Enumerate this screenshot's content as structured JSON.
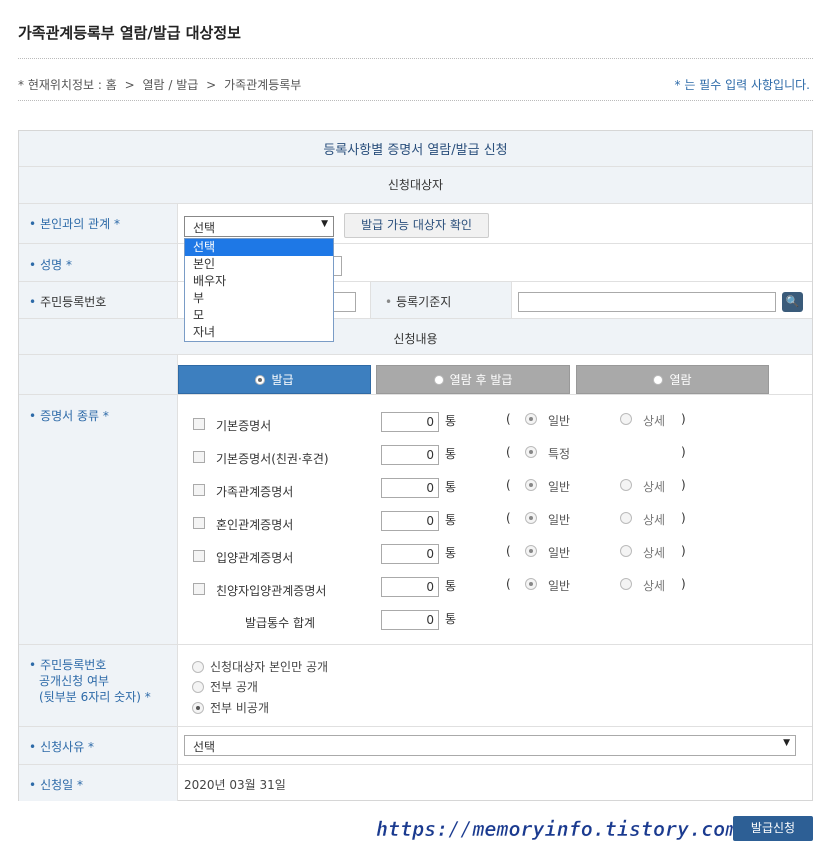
{
  "page": {
    "title": "가족관계등록부 열람/발급 대상정보",
    "location": [
      "* 현재위치정보 : 홈",
      ">",
      "열람 / 발급",
      ">",
      "가족관계등록부"
    ],
    "required_note": "* 는 필수 입력 사항입니다."
  },
  "form": {
    "caption": "등록사항별 증명서 열람/발급 신청",
    "section_applicant": "신청대상자",
    "relation_label": "본인과의 관계 *",
    "relation_value": "선택",
    "relation_options": [
      "선택",
      "본인",
      "배우자",
      "부",
      "모",
      "자녀"
    ],
    "check_button": "발급 가능 대상자 확인",
    "name_label": "성명 *",
    "rrn_label": "주민등록번호",
    "base_label": "등록기준지",
    "section_content": "신청내용",
    "tabs": [
      "발급",
      "열람 후 발급",
      "열람"
    ],
    "cert_type_label": "증명서 종류 *",
    "certificates": [
      {
        "label": "기본증명서",
        "count": "0",
        "unit": "통",
        "opt1": "일반",
        "opt2": "상세"
      },
      {
        "label": "기본증명서(친권·후견)",
        "count": "0",
        "unit": "통",
        "opt1": "특정",
        "opt2": ""
      },
      {
        "label": "가족관계증명서",
        "count": "0",
        "unit": "통",
        "opt1": "일반",
        "opt2": "상세"
      },
      {
        "label": "혼인관계증명서",
        "count": "0",
        "unit": "통",
        "opt1": "일반",
        "opt2": "상세"
      },
      {
        "label": "입양관계증명서",
        "count": "0",
        "unit": "통",
        "opt1": "일반",
        "opt2": "상세"
      },
      {
        "label": "친양자입양관계증명서",
        "count": "0",
        "unit": "통",
        "opt1": "일반",
        "opt2": "상세"
      }
    ],
    "total_label": "발급통수 합계",
    "total_count": "0",
    "total_unit": "통",
    "paren_open": "(",
    "paren_close": ")",
    "disclose_label": [
      "주민등록번호",
      "공개신청 여부",
      "(뒷부분 6자리 숫자) *"
    ],
    "disclose_options": [
      "신청대상자 본인만 공개",
      "전부 공개",
      "전부 비공개"
    ],
    "reason_label": "신청사유 *",
    "reason_value": "선택",
    "date_label": "신청일 *",
    "date_value": "2020년 03월 31일"
  },
  "watermark": "https://memoryinfo.tistory.com",
  "submit_button": "발급신청",
  "colors": {
    "accent": "#2d6aa8",
    "tab_active": "#3d7fbf",
    "tab_inactive": "#a7a7a7",
    "dropdown_highlight": "#1e78e6"
  }
}
